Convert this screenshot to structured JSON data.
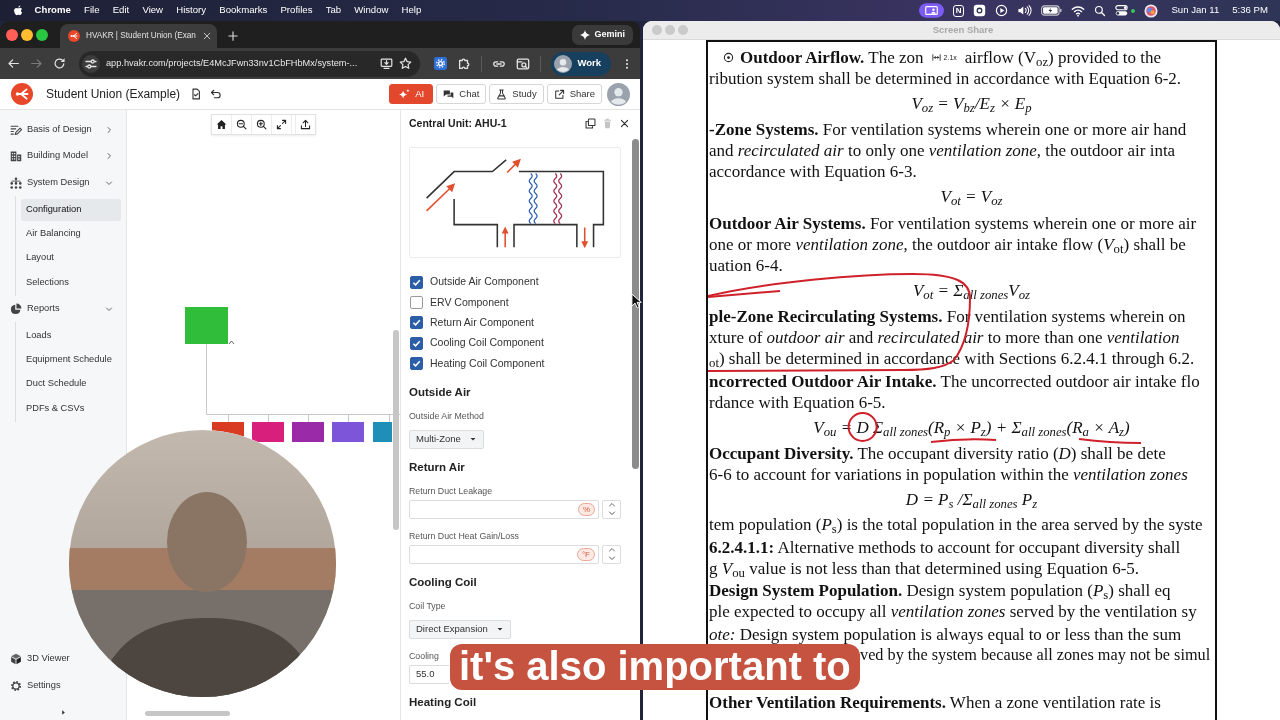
{
  "menu_bar": {
    "app": "Chrome",
    "menus": [
      "File",
      "Edit",
      "View",
      "History",
      "Bookmarks",
      "Profiles",
      "Tab",
      "Window",
      "Help"
    ],
    "app_badge": "N",
    "date": "Sun Jan 11",
    "time": "5:36 PM"
  },
  "browser": {
    "tabs": [
      {
        "title": "HVAKR | Student Union (Exan",
        "selected": true
      }
    ],
    "assistant_button": "Gemini",
    "url": "app.hvakr.com/projects/E4McJFwn33nv1CbFHbMx/system-...",
    "profile": "Work"
  },
  "app": {
    "project_title": "Student Union (Example)",
    "header_buttons": [
      {
        "kind": "ai",
        "label": "AI"
      },
      {
        "kind": "chat",
        "label": "Chat"
      },
      {
        "kind": "study",
        "label": "Study"
      },
      {
        "kind": "share",
        "label": "Share"
      }
    ]
  },
  "sidebar": {
    "items": [
      {
        "label": "Basis of Design",
        "expanded": false,
        "selected": false
      },
      {
        "label": "Building Model",
        "expanded": false,
        "selected": false
      },
      {
        "label": "System Design",
        "expanded": true,
        "selected": false,
        "children": [
          {
            "label": "Configuration",
            "selected": true
          },
          {
            "label": "Air Balancing",
            "selected": false
          },
          {
            "label": "Layout",
            "selected": false
          },
          {
            "label": "Selections",
            "selected": false
          }
        ]
      },
      {
        "label": "Reports",
        "expanded": true,
        "selected": false,
        "children": [
          {
            "label": "Loads",
            "selected": false
          },
          {
            "label": "Equipment Schedule",
            "selected": false
          },
          {
            "label": "Duct Schedule",
            "selected": false
          },
          {
            "label": "PDFs & CSVs",
            "selected": false
          }
        ]
      }
    ],
    "footer_items": [
      {
        "label": "3D Viewer",
        "selected": false
      },
      {
        "label": "Settings",
        "selected": false
      }
    ]
  },
  "diagram": {
    "zones": [
      {
        "color": "#d93a22"
      },
      {
        "color": "#d81f7c"
      },
      {
        "color": "#9b2aa8"
      },
      {
        "color": "#7d55d8"
      },
      {
        "color": "#1f8fb8"
      }
    ]
  },
  "panel": {
    "title": "Central Unit: AHU-1",
    "delete_disabled": true,
    "components": [
      {
        "label": "Outside Air Component",
        "checked": true
      },
      {
        "label": "ERV Component",
        "checked": false
      },
      {
        "label": "Return Air Component",
        "checked": true
      },
      {
        "label": "Cooling Coil Component",
        "checked": true
      },
      {
        "label": "Heating Coil Component",
        "checked": true
      }
    ],
    "sections": [
      {
        "heading": "Outside Air",
        "fields": [
          {
            "kind": "select",
            "label": "Outside Air Method",
            "value": "Multi-Zone"
          }
        ]
      },
      {
        "heading": "Return Air",
        "fields": [
          {
            "kind": "number",
            "label": "Return Duct Leakage",
            "unit": "%"
          },
          {
            "kind": "number",
            "label": "Return Duct Heat Gain/Loss",
            "unit": "°F"
          }
        ]
      },
      {
        "heading": "Cooling Coil",
        "fields": [
          {
            "kind": "select",
            "label": "Coil Type",
            "value": "Direct Expansion"
          },
          {
            "kind": "number",
            "label": "Cooling",
            "value": "55.0"
          }
        ]
      },
      {
        "heading": "Heating Coil"
      }
    ]
  },
  "screen_share": {
    "title": "Screen Share",
    "zoom_level": "2.1x",
    "lines": [
      {
        "kind": "split",
        "text": "**Outdoor Airflow.** The zon",
        "text_after": "airflow (V$_{oz}$) provided to the"
      },
      {
        "kind": "text",
        "text": "ribution system shall be determined in accordance with Equation 6-2."
      },
      {
        "kind": "equation",
        "text": "V$_{oz}$ = V$_{bz}$/E$_{z}$ × E$_{p}$"
      },
      {
        "kind": "lead",
        "text": "**-Zone Systems.** For ventilation systems wherein one or more air hand"
      },
      {
        "kind": "text",
        "text": "and *recirculated air* to only one *ventilation zone*, the outdoor air inta"
      },
      {
        "kind": "text",
        "text": "accordance with Equation 6-3."
      },
      {
        "kind": "equation",
        "text": "V$_{ot}$ = V$_{oz}$"
      },
      {
        "kind": "lead",
        "text": "**Outdoor Air Systems.** For ventilation systems wherein one or more air"
      },
      {
        "kind": "text",
        "text": "one or more *ventilation zone*, the outdoor air intake flow (*V*$_{ot}$) shall be"
      },
      {
        "kind": "text",
        "text": "uation 6-4."
      },
      {
        "kind": "equation",
        "text": "V$_{ot}$ = Σ$_{all zones}$V$_{oz}$"
      },
      {
        "kind": "lead",
        "text": "**ple-Zone Recirculating Systems.** For ventilation systems wherein on"
      },
      {
        "kind": "text",
        "text": "xture of *outdoor air* and *recirculated air* to more than one *ventilation*"
      },
      {
        "kind": "text",
        "text": "$_{ot}$) shall be determined in accordance with Sections 6.2.4.1 through 6.2."
      },
      {
        "kind": "lead",
        "text": "**ncorrected Outdoor Air Intake.** The uncorrected outdoor air intake flo"
      },
      {
        "kind": "text",
        "text": "rdance with Equation 6-5."
      },
      {
        "kind": "equation",
        "parts": [
          {
            "text": "V$_{ou}$ =",
            "circled": false
          },
          {
            "text": "D",
            "circled": true
          },
          {
            "text": "Σ$_{all zones}$(R$_{p}$ × P$_{z}$) + Σ$_{all zones}$(R$_{a}$ × A$_{z}$)",
            "circled": false
          }
        ]
      },
      {
        "kind": "lead",
        "text": "**Occupant Diversity.** The occupant diversity ratio (*D*) shall be dete"
      },
      {
        "kind": "text",
        "text": "6-6 to account for variations in population within the *ventilation zones*"
      },
      {
        "kind": "equation",
        "text": "D = P$_{s}$ /Σ$_{all zones}$ P$_{z}$"
      },
      {
        "kind": "text",
        "text": "tem population (*P*$_{s}$) is the total population in the area served by the syste"
      },
      {
        "kind": "lead",
        "text": "**6.2.4.1.1:** Alternative methods to account for occupant diversity shall"
      },
      {
        "kind": "text",
        "text": "g *V*$_{ou}$ value is not less than that determined using Equation 6-5."
      },
      {
        "kind": "lead",
        "text": "**Design System Population.** Design system population (*P*$_{s}$) shall eq"
      },
      {
        "kind": "text",
        "text": "ple expected to occupy all *ventilation zones* served by the ventilation sy"
      },
      {
        "kind": "lead",
        "text": "*ote:* Design system population is always equal to or less than the sum"
      },
      {
        "kind": "covered",
        "text": "ved by the system because all zones may not be simul"
      },
      {
        "kind": "lead",
        "text": "**Other Ventilation Requirements.** When a zone ventilation rate is"
      }
    ]
  },
  "caption": "it's also important to"
}
